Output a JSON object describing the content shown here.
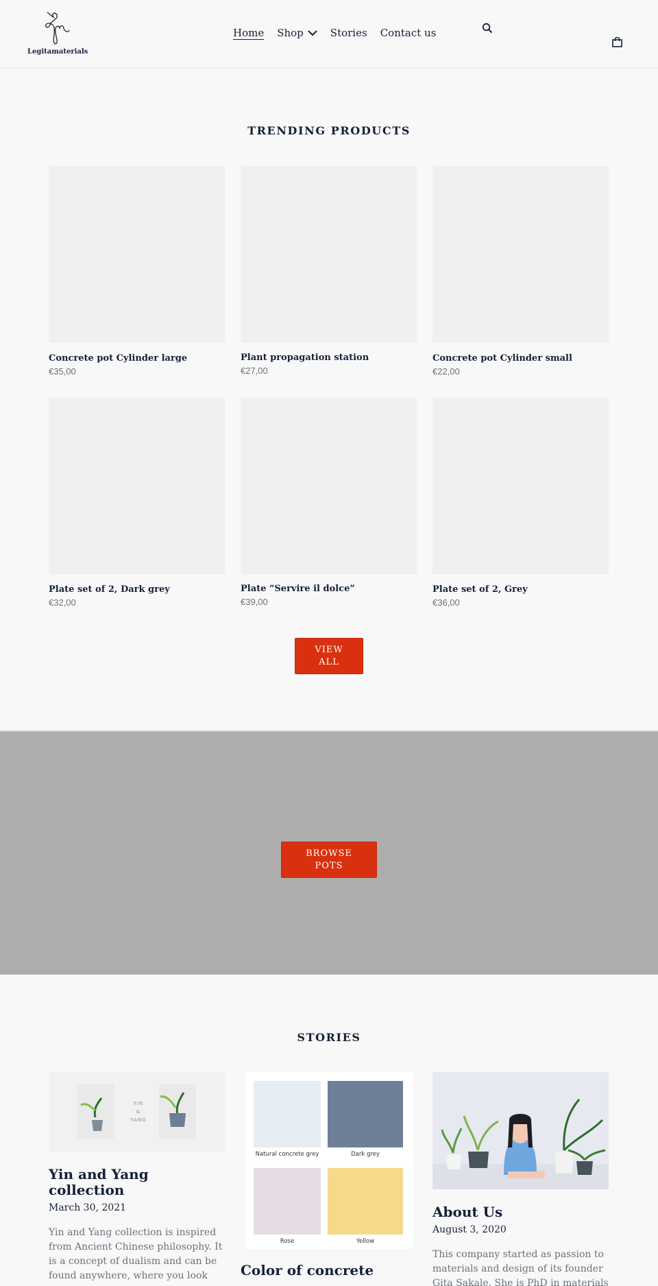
{
  "header": {
    "brand": "Legitamaterials",
    "nav": [
      {
        "label": "Home",
        "active": true
      },
      {
        "label": "Shop",
        "has_dropdown": true
      },
      {
        "label": "Stories"
      },
      {
        "label": "Contact us"
      }
    ],
    "icons": {
      "search": "search-icon",
      "cart": "shopping-bag-icon",
      "dropdown": "chevron-down-icon"
    }
  },
  "trending": {
    "title": "TRENDING PRODUCTS",
    "products": [
      {
        "name": "Concrete pot Cylinder large",
        "price": "€35,00"
      },
      {
        "name": "Plant propagation station",
        "price": "€27,00"
      },
      {
        "name": "Concrete pot Cylinder small",
        "price": "€22,00"
      },
      {
        "name": "Plate set of 2, Dark grey",
        "price": "€32,00"
      },
      {
        "name": "Plate “Servire il dolce”",
        "price": "€39,00"
      },
      {
        "name": "Plate set of 2, Grey",
        "price": "€36,00"
      }
    ],
    "view_all": {
      "line1": "VIEW",
      "line2": "ALL"
    }
  },
  "banner": {
    "button": {
      "line1": "BROWSE",
      "line2": "POTS"
    }
  },
  "stories": {
    "title": "STORIES",
    "items": [
      {
        "title": "Yin and Yang collection",
        "date": "March 30, 2021",
        "excerpt": "Yin and Yang collection is inspired from Ancient Chinese philosophy. It is a concept of dualism and can be found anywhere, where you look",
        "image_text": {
          "line1": "YIN",
          "line2": "&",
          "line3": "YANG"
        }
      },
      {
        "title": "Color of concrete",
        "swatches": [
          {
            "label": "Natural concrete grey",
            "color": "#e6edf3"
          },
          {
            "label": "Dark grey",
            "color": "#6f7f98"
          },
          {
            "label": "Rose",
            "color": "#e7dbe6"
          },
          {
            "label": "Yellow",
            "color": "#f7d98a"
          }
        ]
      },
      {
        "title": "About Us",
        "date": "August 3, 2020",
        "excerpt": "This company started as passion to materials and design of its founder Gita Sakale. She is PhD in materials"
      }
    ]
  },
  "colors": {
    "accent": "#d9310f",
    "text": "#152036",
    "muted": "#69727b",
    "banner": "#adadad",
    "background": "#f8f8f8",
    "placeholder": "#f0f0f2"
  }
}
